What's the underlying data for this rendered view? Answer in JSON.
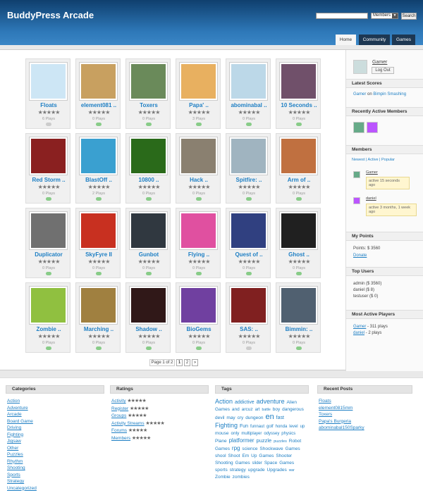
{
  "header": {
    "title": "BuddyPress Arcade",
    "search_select": "Members",
    "search_button": "Search"
  },
  "tabs": [
    "Home",
    "Community",
    "Games"
  ],
  "games": [
    {
      "name": "Floats",
      "plays": "6 Plays",
      "color": "#cde6f5",
      "gray": true
    },
    {
      "name": "element081 ..",
      "plays": "0 Plays",
      "color": "#c8a060"
    },
    {
      "name": "Toxers",
      "plays": "0 Plays",
      "color": "#6a8a5a"
    },
    {
      "name": "Papa' ..",
      "plays": "3 Plays",
      "color": "#e8b060"
    },
    {
      "name": "abominabal ..",
      "plays": "0 Plays",
      "color": "#bcd8e8"
    },
    {
      "name": "10 Seconds ..",
      "plays": "0 Plays",
      "color": "#70506a"
    },
    {
      "name": "Red Storm ..",
      "plays": "0 Plays",
      "color": "#8a2020"
    },
    {
      "name": "BlastOff ..",
      "plays": "2 Plays",
      "color": "#3aa0d0"
    },
    {
      "name": "10800 ..",
      "plays": "0 Plays",
      "color": "#2a6a1a"
    },
    {
      "name": "Hack ..",
      "plays": "0 Plays",
      "color": "#8a8070"
    },
    {
      "name": "Spitfire: ..",
      "plays": "0 Plays",
      "color": "#a0b4c0"
    },
    {
      "name": "Arm of ..",
      "plays": "0 Plays",
      "color": "#c07040"
    },
    {
      "name": "Duplicator",
      "plays": "0 Plays",
      "color": "#707070"
    },
    {
      "name": "SkyFyre II",
      "plays": "0 Plays",
      "color": "#c83020"
    },
    {
      "name": "Gunbot",
      "plays": "0 Plays",
      "color": "#303840"
    },
    {
      "name": "Flying ..",
      "plays": "0 Plays",
      "color": "#e050a0"
    },
    {
      "name": "Quest of ..",
      "plays": "0 Plays",
      "color": "#304080"
    },
    {
      "name": "Ghost ..",
      "plays": "0 Plays",
      "color": "#202020"
    },
    {
      "name": "Zombie ..",
      "plays": "0 Plays",
      "color": "#90c040"
    },
    {
      "name": "Marching ..",
      "plays": "0 Plays",
      "color": "#a08040"
    },
    {
      "name": "Shadow ..",
      "plays": "0 Plays",
      "color": "#301818"
    },
    {
      "name": "BioGems",
      "plays": "0 Plays",
      "color": "#7040a0"
    },
    {
      "name": "SAS: ..",
      "plays": "0 Plays",
      "color": "#802020",
      "gray": true
    },
    {
      "name": "Bimmin: ..",
      "plays": "0 Plays",
      "color": "#506070"
    }
  ],
  "pager": {
    "label": "Page 1 of 2",
    "pages": [
      "1",
      "2",
      "»"
    ]
  },
  "sidebar": {
    "user": "Gamer",
    "logout": "Log Out",
    "latest_scores_title": "Latest Scores",
    "latest_scores_user": "Gamer",
    "latest_scores_on": "on",
    "latest_scores_game": "Bimpin Smashing",
    "recent_members_title": "Recently Active Members",
    "members_title": "Members",
    "members_filter": "Newest | Active | Popular",
    "member1": "Gamer",
    "member1_status": "active 15 seconds ago",
    "member2": "daniel",
    "member2_status": "active 3 months, 1 week ago",
    "points_title": "My Points",
    "points": "Points: $ 3560",
    "donate": "Donate",
    "top_users_title": "Top Users",
    "top_users": [
      "admin ($ 3560)",
      "daniel ($ 8)",
      "testuser ($ 0)"
    ],
    "most_active_title": "Most Active Players",
    "most_active": [
      {
        "user": "Gamer",
        "detail": " - 311 plays"
      },
      {
        "user": "daniel",
        "detail": " - 2 plays"
      }
    ]
  },
  "footer": {
    "categories_title": "Categories",
    "categories": [
      "Action",
      "Adventure",
      "Arcade",
      "Board Game",
      "Driving",
      "Fighting",
      "Jigsaw",
      "Other",
      "Puzzles",
      "Rhythm",
      "Shooting",
      "Sports",
      "Strategy",
      "Uncategorized"
    ],
    "ratings_title": "Ratings",
    "ratings": [
      "Activity",
      "Register",
      "Groups",
      "Activity Streams",
      "Forums",
      "Members"
    ],
    "tags_title": "Tags",
    "tags": [
      [
        "Action",
        9
      ],
      [
        "addictive",
        7
      ],
      [
        "adventure",
        9
      ],
      [
        "Alien",
        6.5
      ],
      [
        "Games",
        6.5
      ],
      [
        "and",
        6.5
      ],
      [
        "arcuz",
        6.5
      ],
      [
        "art",
        6
      ],
      [
        "battle",
        5
      ],
      [
        "boy",
        6.5
      ],
      [
        "dangerous",
        6.5
      ],
      [
        "devil",
        6.5
      ],
      [
        "may",
        6.5
      ],
      [
        "cry",
        6.5
      ],
      [
        "dungeon",
        6.5
      ],
      [
        "en",
        11
      ],
      [
        "fast",
        7
      ],
      [
        "Fighting",
        9
      ],
      [
        "Fun",
        7
      ],
      [
        "funnaut",
        6
      ],
      [
        "golf",
        6
      ],
      [
        "honda",
        6
      ],
      [
        "level",
        6
      ],
      [
        "up",
        6
      ],
      [
        "mouse",
        6.5
      ],
      [
        "only",
        6.5
      ],
      [
        "multiplayer",
        6
      ],
      [
        "odyssey",
        6
      ],
      [
        "physics",
        6
      ],
      [
        "Plane",
        6.5
      ],
      [
        "platformer",
        8
      ],
      [
        "puzzle",
        7.5
      ],
      [
        "puzzles",
        5.5
      ],
      [
        "Robot",
        6.5
      ],
      [
        "Games",
        6.5
      ],
      [
        "rpg",
        8
      ],
      [
        "science",
        6.5
      ],
      [
        "Shockwave",
        6.5
      ],
      [
        "Games",
        6.5
      ],
      [
        "shool",
        6.5
      ],
      [
        "Shoot",
        6.5
      ],
      [
        "Em",
        6.5
      ],
      [
        "Up",
        6.5
      ],
      [
        "Games",
        6.5
      ],
      [
        "Shooter",
        6.5
      ],
      [
        "Shooting",
        6.5
      ],
      [
        "Games",
        6.5
      ],
      [
        "slider",
        6
      ],
      [
        "Space",
        6.5
      ],
      [
        "Games",
        6.5
      ],
      [
        "sports",
        6.5
      ],
      [
        "strategy",
        6.5
      ],
      [
        "upgrade",
        6.5
      ],
      [
        "Upgrades",
        6.5
      ],
      [
        "war",
        5
      ],
      [
        "Zombie",
        6.5
      ],
      [
        "zombies",
        6.5
      ]
    ],
    "recent_posts_title": "Recent Posts",
    "recent_posts": [
      "Floats",
      "element0815mm",
      "Toxers",
      "Papa's Burgeria",
      "abominabal150Sparky"
    ]
  }
}
